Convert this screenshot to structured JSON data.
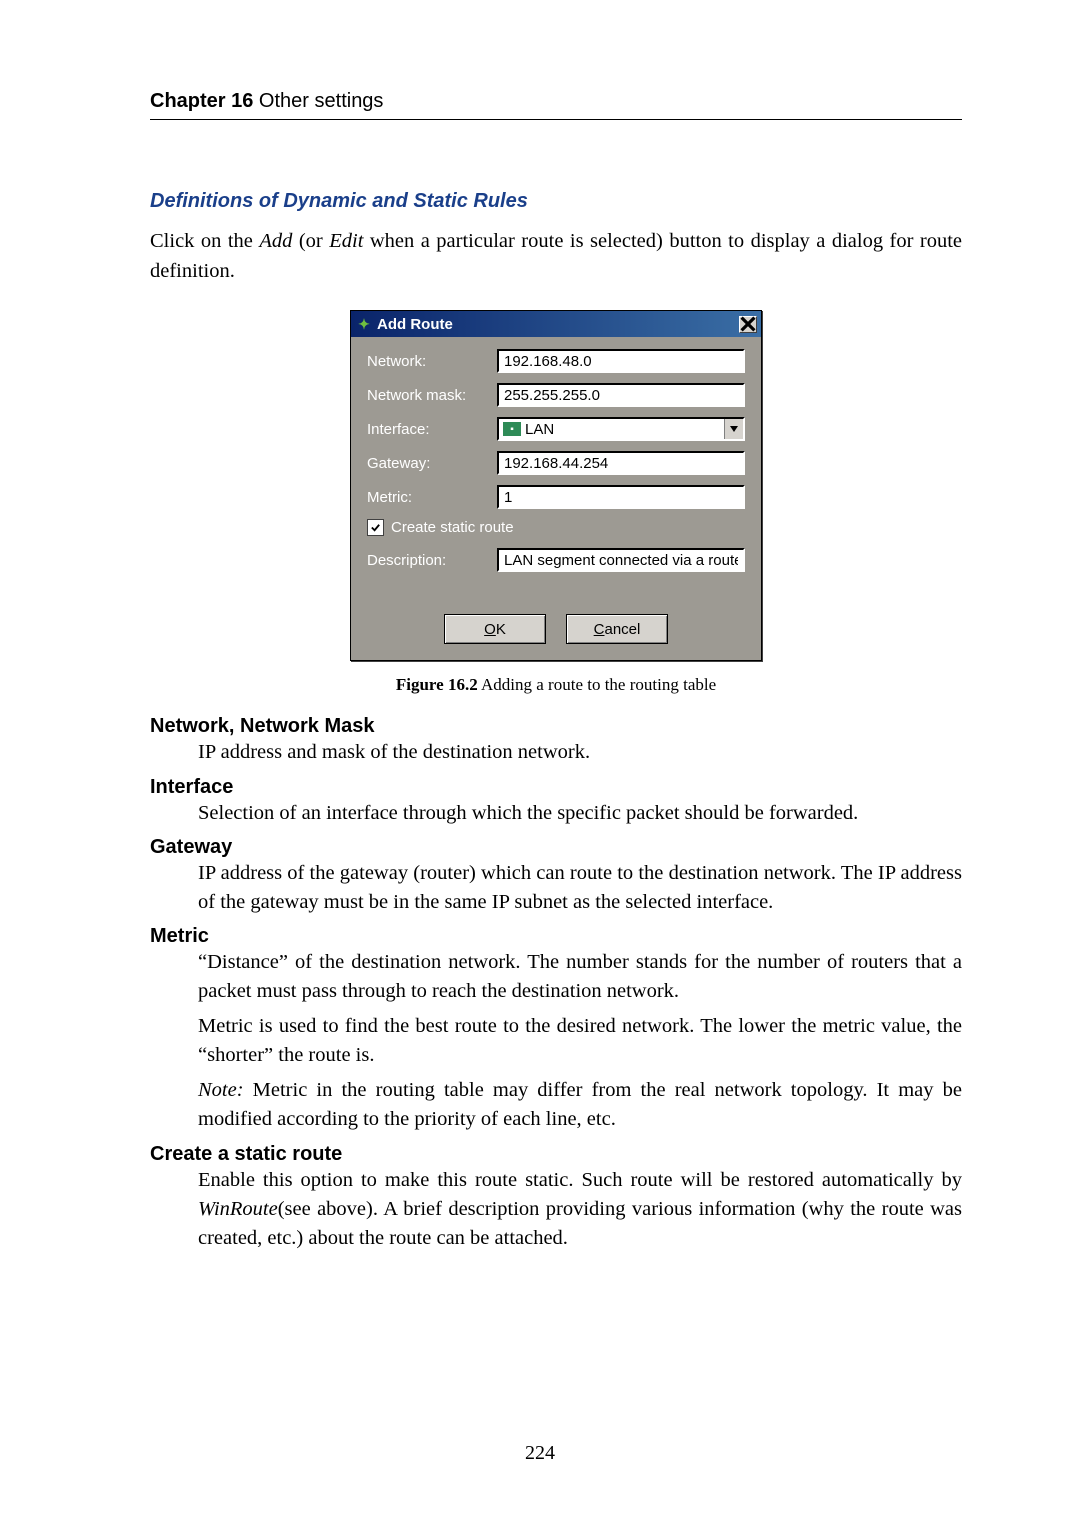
{
  "header": {
    "chapter_bold": "Chapter 16",
    "chapter_rest": "  Other settings"
  },
  "section": {
    "title": "Definitions of Dynamic and Static Rules",
    "intro_before_add": "Click on the ",
    "intro_add": "Add",
    "intro_between": " (or ",
    "intro_edit": "Edit",
    "intro_after": " when a particular route is selected) button to display a dialog for route definition."
  },
  "dialog": {
    "title": "Add Route",
    "labels": {
      "network": "Network:",
      "mask": "Network mask:",
      "interface": "Interface:",
      "gateway": "Gateway:",
      "metric": "Metric:",
      "create_static": "Create static route",
      "description": "Description:"
    },
    "values": {
      "network": "192.168.48.0",
      "mask": "255.255.255.0",
      "interface": "LAN",
      "gateway": "192.168.44.254",
      "metric": "1",
      "description": "LAN segment connected via a router"
    },
    "buttons": {
      "ok_u": "O",
      "ok_rest": "K",
      "cancel_u": "C",
      "cancel_rest": "ancel"
    }
  },
  "caption": {
    "bold": "Figure 16.2",
    "rest": "   Adding a route to the routing table"
  },
  "defs": {
    "netmask_term": "Network, Network Mask",
    "netmask_def": "IP address and mask of the destination network.",
    "interface_term": "Interface",
    "interface_def": "Selection of an interface through which the specific packet should be forwarded.",
    "gateway_term": "Gateway",
    "gateway_def": "IP address of the gateway (router) which can route to the destination network. The IP address of the gateway must be in the same IP subnet as the selected interface.",
    "metric_term": "Metric",
    "metric_p1": "“Distance” of the destination network.  The number stands for the number of routers that a packet must pass through to reach the destination network.",
    "metric_p2": "Metric is used to find the best route to the desired network. The lower the metric value, the “shorter” the route is.",
    "metric_note_lead": "Note:",
    "metric_note_rest": " Metric in the routing table may differ from the real network topology. It may be modified according to the priority of each line, etc.",
    "static_term": "Create a static route",
    "static_before": "Enable this option to make this route static. Such route will be restored automatically by ",
    "static_ital": "WinRoute",
    "static_after": "(see above).  A brief description providing various information (why the route was created, etc.) about the route can be attached."
  },
  "page_number": "224"
}
